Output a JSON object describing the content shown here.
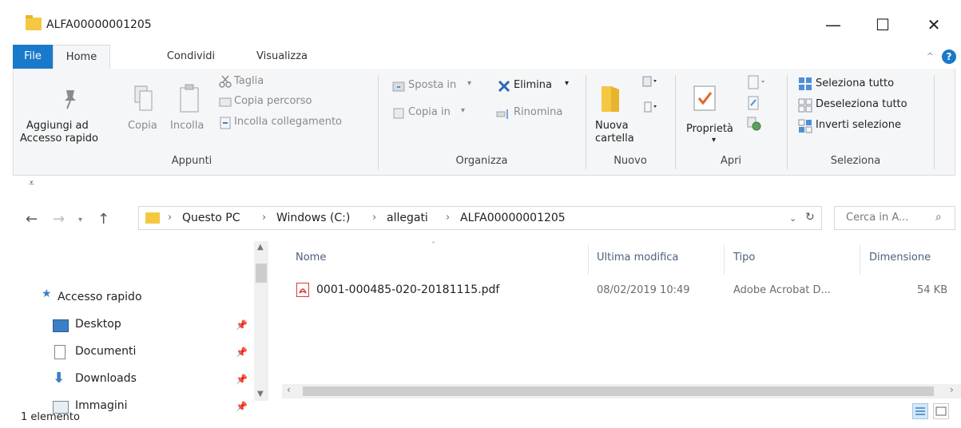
{
  "window": {
    "title": "ALFA00000001205",
    "minimize_label": "—",
    "maximize_label": "☐",
    "close_label": "✕"
  },
  "tabs": [
    {
      "label": "File"
    },
    {
      "label": "Home"
    },
    {
      "label": "Condividi"
    },
    {
      "label": "Visualizza"
    }
  ],
  "ribbon": {
    "appunti": {
      "pin_label_1": "Aggiungi ad",
      "pin_label_2": "Accesso rapido",
      "copy_label": "Copia",
      "paste_label": "Incolla",
      "cut_label": "Taglia",
      "copy_path_label": "Copia percorso",
      "paste_link_label": "Incolla collegamento",
      "group_label": "Appunti"
    },
    "organizza": {
      "move_label": "Sposta in",
      "copy_to_label": "Copia in",
      "delete_label": "Elimina",
      "rename_label": "Rinomina",
      "group_label": "Organizza"
    },
    "nuovo": {
      "new_folder_label_1": "Nuova",
      "new_folder_label_2": "cartella",
      "group_label": "Nuovo"
    },
    "apri": {
      "properties_label": "Proprietà",
      "group_label": "Apri"
    },
    "seleziona": {
      "select_all_label": "Seleziona tutto",
      "deselect_all_label": "Deseleziona tutto",
      "invert_label": "Inverti selezione",
      "group_label": "Seleziona"
    }
  },
  "address": {
    "crumbs": [
      "Questo PC",
      "Windows (C:)",
      "allegati",
      "ALFA00000001205"
    ],
    "search_placeholder": "Cerca in A..."
  },
  "nav_pane": {
    "items": [
      {
        "label": "Accesso rapido",
        "icon": "star-icon"
      },
      {
        "label": "Desktop",
        "icon": "desktop-icon"
      },
      {
        "label": "Documenti",
        "icon": "documents-icon"
      },
      {
        "label": "Downloads",
        "icon": "download-icon"
      },
      {
        "label": "Immagini",
        "icon": "pictures-icon"
      }
    ]
  },
  "file_list": {
    "columns": [
      "Nome",
      "Ultima modifica",
      "Tipo",
      "Dimensione"
    ],
    "rows": [
      {
        "name": "0001-000485-020-20181115.pdf",
        "modified": "08/02/2019 10:49",
        "type": "Adobe Acrobat D...",
        "size": "54 KB"
      }
    ]
  },
  "status": {
    "count_label": "1 elemento"
  },
  "colors": {
    "accent": "#1979ca",
    "folder": "#f5c842",
    "pdf_red": "#d83b3b"
  }
}
